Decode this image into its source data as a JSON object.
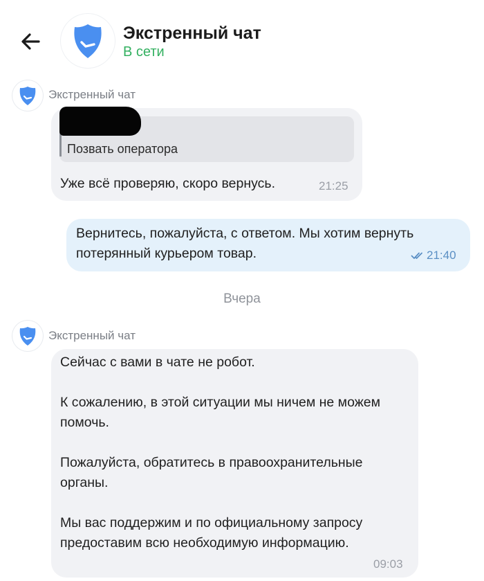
{
  "header": {
    "title": "Экстренный чат",
    "status": "В сети"
  },
  "messages": [
    {
      "sender": "Экстренный чат",
      "quote": "Позвать оператора",
      "text": "Уже всё проверяю, скоро вернусь.",
      "time": "21:25"
    },
    {
      "text": "Вернитесь, пожалуйста, с ответом. Мы хотим вернуть потерянный курьером товар.",
      "time": "21:40"
    },
    {
      "sender": "Экстренный чат",
      "text": "Сейчас с вами в чате не робот.\n\nК сожалению, в этой ситуации мы ничем не можем помочь.\n\nПожалуйста, обратитесь в правоохранительные органы.\n\nМы вас поддержим и по официальному запросу предоставим всю необходимую информацию.",
      "time": "09:03"
    }
  ],
  "date_separator": "Вчера",
  "colors": {
    "status_online": "#33b060",
    "shield_blue": "#4a8ff0",
    "bubble_incoming": "#f1f2f5",
    "bubble_outgoing": "#e4f1fb",
    "read_check": "#5a8fc4"
  },
  "icons": {
    "back": "arrow-left-icon",
    "avatar": "shield-check-icon",
    "read": "double-check-icon"
  }
}
